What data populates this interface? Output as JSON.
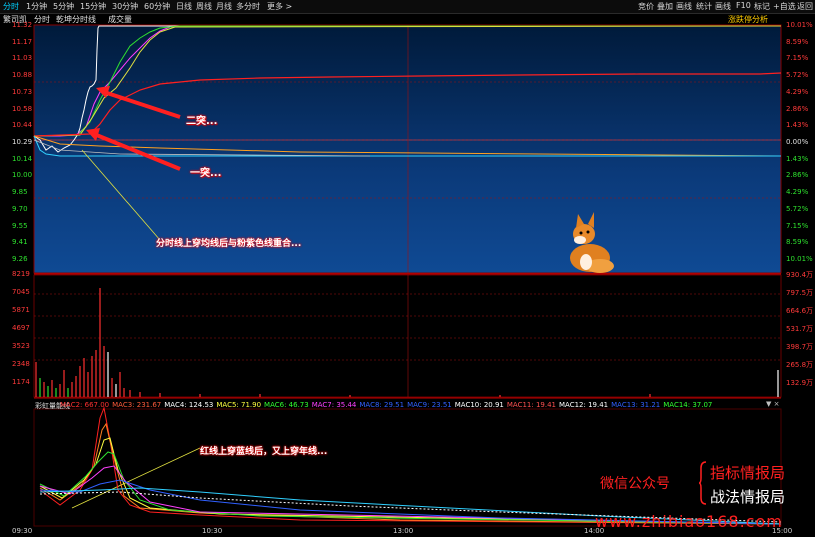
{
  "toolbar": {
    "tabs": [
      "分时",
      "1分钟",
      "5分钟",
      "15分钟",
      "30分钟",
      "60分钟",
      "日线",
      "周线",
      "月线",
      "多分时",
      "更多 >"
    ],
    "right_items": [
      "竞价",
      "叠加",
      "画线",
      "统计",
      "画线",
      "F10",
      "标记",
      "+自选",
      "返回"
    ]
  },
  "titlebar": {
    "left": [
      "繁司凯",
      "分时",
      "乾坤分时线",
      "成交量"
    ],
    "right": "涨跌停分析"
  },
  "price_axis": {
    "left": [
      "11.32",
      "11.17",
      "11.03",
      "10.88",
      "10.73",
      "10.58",
      "10.44",
      "10.29",
      "10.14",
      "10.00",
      "9.85",
      "9.70",
      "9.55",
      "9.41",
      "9.26"
    ],
    "right": [
      "10.01%",
      "8.59%",
      "7.15%",
      "5.72%",
      "4.29%",
      "2.86%",
      "1.43%",
      "0.00%",
      "1.43%",
      "2.86%",
      "4.29%",
      "5.72%",
      "7.15%",
      "8.59%",
      "10.01%"
    ]
  },
  "volume_axis": {
    "left": [
      "8219",
      "7045",
      "5871",
      "4697",
      "3523",
      "2348",
      "1174"
    ],
    "right": [
      "930.4万",
      "797.5万",
      "664.6万",
      "531.7万",
      "398.7万",
      "265.8万",
      "132.9万"
    ]
  },
  "mac_legend": {
    "title": "彩虹量能线",
    "items": [
      {
        "label": "MAC2: 667.00",
        "color": "#ff3030"
      },
      {
        "label": "MAC3: 231.67",
        "color": "#ff5a3a"
      },
      {
        "label": "MAC4: 124.53",
        "color": "#ffffff"
      },
      {
        "label": "MAC5: 71.90",
        "color": "#ffff40"
      },
      {
        "label": "MAC6: 46.73",
        "color": "#30ff30"
      },
      {
        "label": "MAC7: 35.44",
        "color": "#ff40ff"
      },
      {
        "label": "MAC8: 29.51",
        "color": "#3060ff"
      },
      {
        "label": "MAC9: 23.51",
        "color": "#3060ff"
      },
      {
        "label": "MAC10: 20.91",
        "color": "#ffffff"
      },
      {
        "label": "MAC11: 19.41",
        "color": "#ff5050"
      },
      {
        "label": "MAC12: 19.41",
        "color": "#ffffff"
      },
      {
        "label": "MAC13: 31.21",
        "color": "#3060ff"
      },
      {
        "label": "MAC14: 37.07",
        "color": "#30ff30"
      }
    ]
  },
  "time_axis": [
    "09:30",
    "10:30",
    "13:00",
    "14:00",
    "15:00"
  ],
  "annotations": {
    "second_break": "二突...",
    "first_break": "一突...",
    "cross_note": "分时线上穿均线后与粉紫色线重合...",
    "mac_note": "红线上穿蓝线后，又上穿年线..."
  },
  "watermark": {
    "wechat": "微信公众号",
    "brand1": "指标情报局",
    "brand2": "战法情报局",
    "url": "www.zhibiao168.com"
  },
  "colors": {
    "background": "#000000",
    "price_bg_top": "#001a3a",
    "price_bg_bottom": "#0f4a94",
    "up": "#ff3a3a",
    "down": "#2ee02e"
  },
  "chart_data": {
    "type": "line",
    "x": [
      "09:30",
      "10:30",
      "13:00",
      "14:00",
      "15:00"
    ],
    "prev_close": 10.29,
    "ylim": [
      9.26,
      11.32
    ]
  }
}
